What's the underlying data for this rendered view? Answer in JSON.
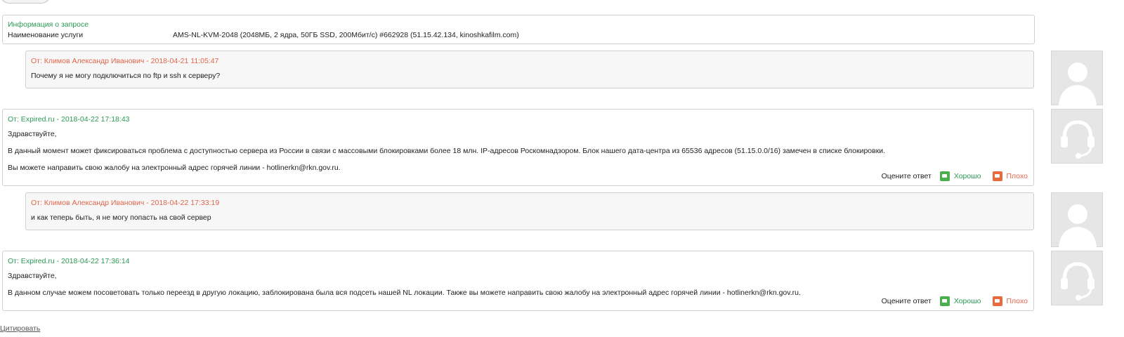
{
  "info": {
    "title": "Информация о запросе",
    "service_label": "Наименование услуги",
    "service_value": "AMS-NL-KVM-2048 (2048МБ, 2 ядра, 50ГБ SSD, 200Мбит/с) #662928 (51.15.42.134, kinoshkafilm.com)"
  },
  "messages": [
    {
      "header": "От: Климов Александр Иванович - 2018-04-21 11:05:47",
      "lines": [
        "Почему я не могу подключиться по ftp и ssh к серверу?"
      ]
    },
    {
      "header": "От: Expired.ru - 2018-04-22 17:18:43",
      "lines": [
        "Здравствуйте,",
        "В данный момент может фиксироваться проблема с доступностью сервера из России в связи с массовыми блокировками более 18 млн. IP-адресов Роскомнадзором. Блок нашего дата-центра из 65536 адресов (51.15.0.0/16) замечен в списке блокировки.",
        "Вы можете направить свою жалобу на электронный адрес горячей линии - hotlinerkn@rkn.gov.ru."
      ]
    },
    {
      "header": "От: Климов Александр Иванович - 2018-04-22 17:33:19",
      "lines": [
        "и как теперь быть, я не могу попасть на свой сервер"
      ]
    },
    {
      "header": "От: Expired.ru - 2018-04-22 17:36:14",
      "lines": [
        "Здравствуйте,",
        "В данном случае можем посоветовать только переезд в другую локацию, заблокирована была вся подсеть нашей NL локации. Также вы можете направить свою жалобу на электронный адрес горячей линии - hotlinerkn@rkn.gov.ru."
      ]
    }
  ],
  "rating": {
    "label": "Оцените ответ",
    "good": "Хорошо",
    "bad": "Плохо"
  },
  "quote_link": "Цитировать",
  "colors": {
    "support_header": "#2a9a55",
    "client_header": "#e0654a",
    "good": "#4cae4c",
    "bad": "#e86a3c"
  },
  "icons": {
    "client_avatar": "user-silhouette-icon",
    "support_avatar": "headset-icon",
    "good": "thumbs-up-icon",
    "bad": "thumbs-down-icon"
  }
}
